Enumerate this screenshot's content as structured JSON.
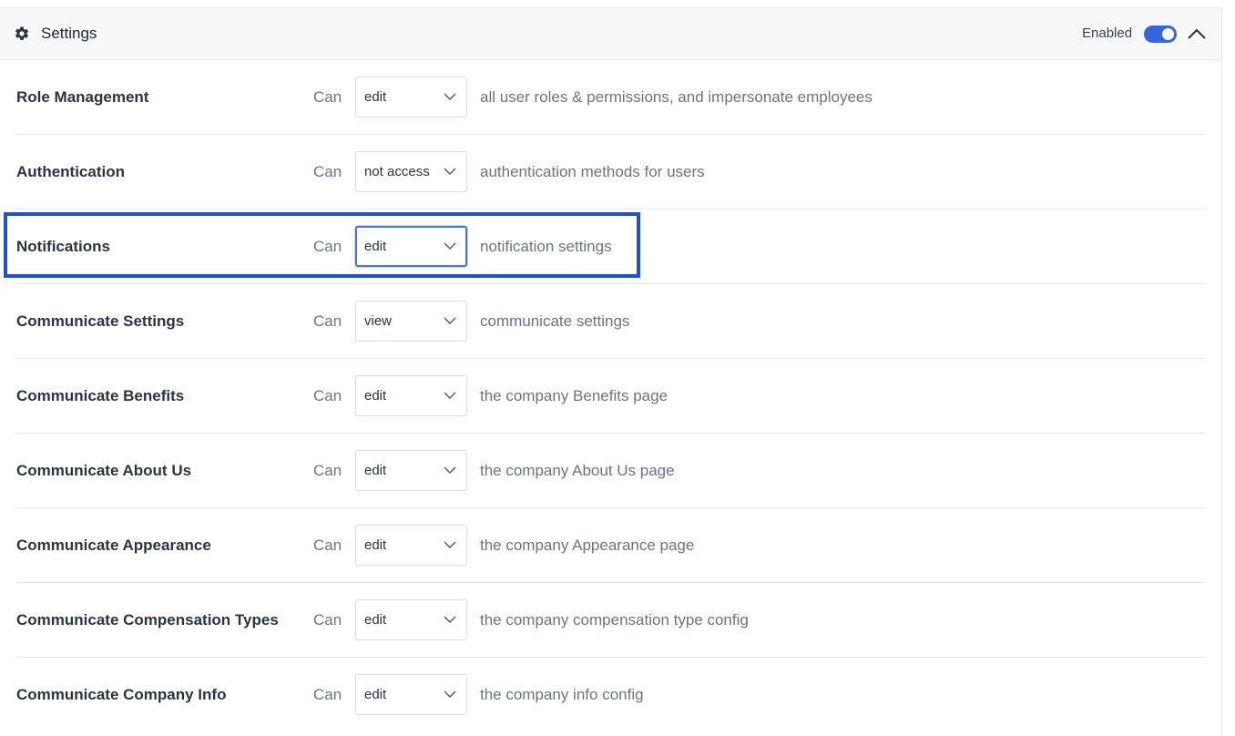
{
  "header": {
    "title": "Settings",
    "icon": "gear-icon",
    "enabled_label": "Enabled",
    "toggle_on": true,
    "accent_color": "#3466e0"
  },
  "rows": [
    {
      "name": "Role Management",
      "can": "Can",
      "value": "edit",
      "desc": "all user roles & permissions, and impersonate employees"
    },
    {
      "name": "Authentication",
      "can": "Can",
      "value": "not access",
      "desc": "authentication methods for users"
    },
    {
      "name": "Notifications",
      "can": "Can",
      "value": "edit",
      "desc": "notification settings",
      "focused": true
    },
    {
      "name": "Communicate Settings",
      "can": "Can",
      "value": "view",
      "desc": "communicate settings"
    },
    {
      "name": "Communicate Benefits",
      "can": "Can",
      "value": "edit",
      "desc": "the company Benefits page"
    },
    {
      "name": "Communicate About Us",
      "can": "Can",
      "value": "edit",
      "desc": "the company About Us page"
    },
    {
      "name": "Communicate Appearance",
      "can": "Can",
      "value": "edit",
      "desc": "the company Appearance page"
    },
    {
      "name": "Communicate Compensation Types",
      "can": "Can",
      "value": "edit",
      "desc": "the company compensation type config"
    },
    {
      "name": "Communicate Company Info",
      "can": "Can",
      "value": "edit",
      "desc": "the company info config"
    }
  ],
  "highlight_color": "#1f4fd8"
}
